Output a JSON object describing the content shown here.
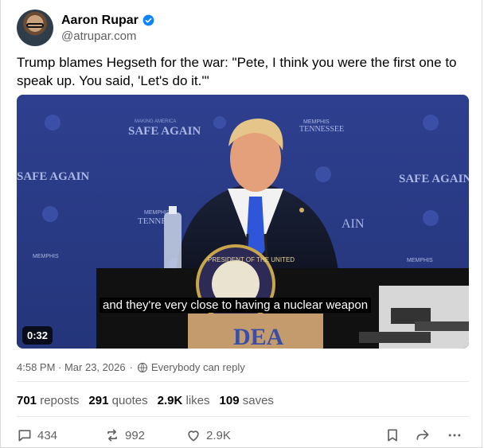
{
  "author": {
    "display_name": "Aaron Rupar",
    "handle": "@atrupar.com"
  },
  "post": {
    "text": "Trump blames Hegseth for the war: \"Pete, I think you were the first one to speak up. You said, 'Let's do it.'\""
  },
  "media": {
    "caption": "and they're very close to having a nuclear weapon",
    "duration": "0:32",
    "backdrop_text": {
      "safe_again_1": "SAFE AGAIN",
      "safe_again_2": "SAFE AGAIN",
      "safe_again_3": "SAFE AGAIN",
      "making_america": "MAKING AMERICA",
      "memphis_tennessee_1": "MEMPHIS",
      "tennessee_1": "TENNESSEE",
      "memphis_2": "MEMPHIS",
      "tenne_2": "TENNE",
      "agin_fragment": "AIN",
      "memphis_3": "MEMPHIS",
      "memphis_4": "MEMPHIS",
      "seal_text": "PRESIDENT OF THE UNITED",
      "box_text": "DEA"
    }
  },
  "meta": {
    "timestamp": "4:58 PM · Mar 23, 2026",
    "reply_setting": "Everybody can reply"
  },
  "stats": {
    "reposts_count": "701",
    "reposts_label": "reposts",
    "quotes_count": "291",
    "quotes_label": "quotes",
    "likes_count": "2.9K",
    "likes_label": "likes",
    "saves_count": "109",
    "saves_label": "saves"
  },
  "actions": {
    "reply_count": "434",
    "repost_count": "992",
    "like_count": "2.9K"
  },
  "colors": {
    "verified": "#1083fe",
    "muted_text": "#606060",
    "backdrop_blue": "#2d3f8f"
  }
}
